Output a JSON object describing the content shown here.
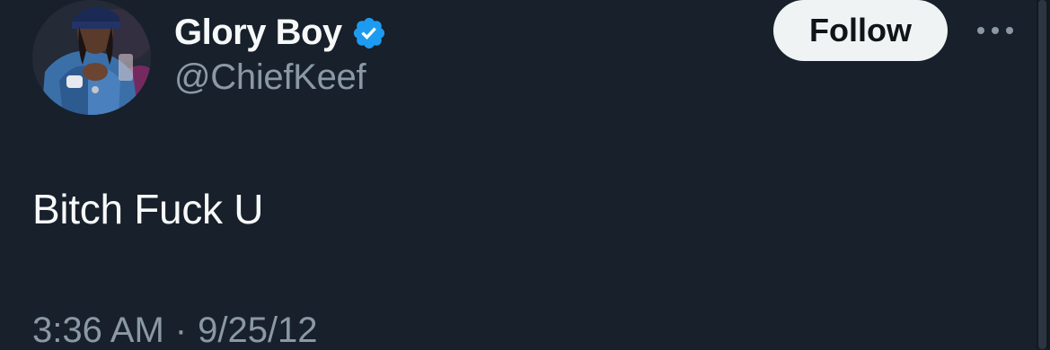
{
  "tweet": {
    "author": {
      "display_name": "Glory Boy",
      "handle": "@ChiefKeef",
      "verified": true,
      "avatar_icon": "user-avatar-photo"
    },
    "follow_label": "Follow",
    "more_icon": "ellipsis-icon",
    "text": "Bitch Fuck U",
    "time": "3:36 AM",
    "separator": "·",
    "date": "9/25/12"
  },
  "colors": {
    "background": "#17202b",
    "primary_text": "#f7f9f9",
    "secondary_text": "#8b98a5",
    "verified_blue": "#1d9bf0",
    "follow_button_bg": "#eff3f4",
    "follow_button_text": "#0f1419"
  }
}
